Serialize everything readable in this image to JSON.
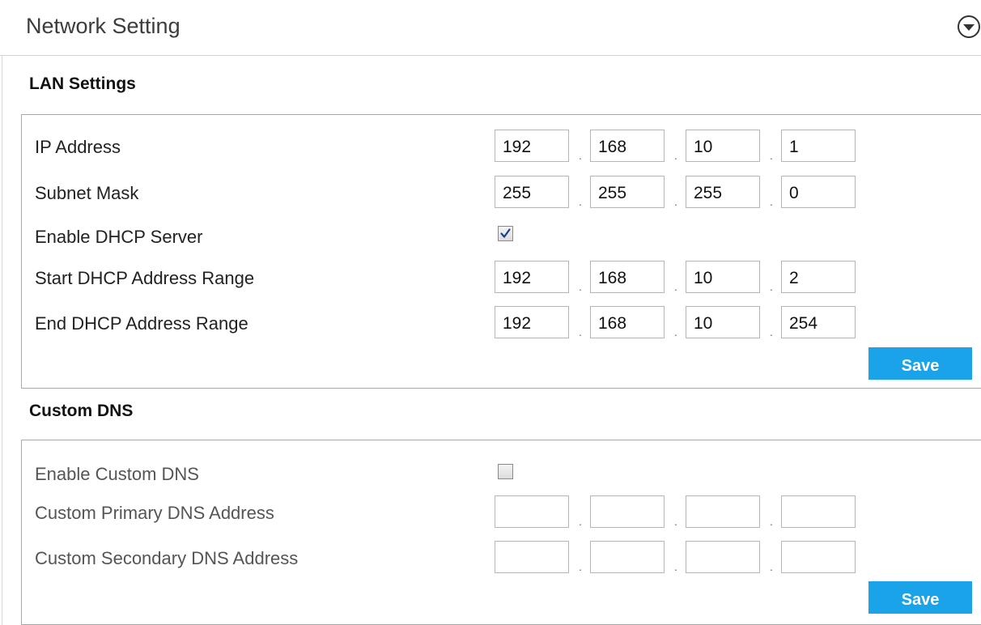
{
  "header": {
    "title": "Network Setting",
    "collapse_icon": "chevron-down-circle-icon"
  },
  "lan": {
    "title": "LAN Settings",
    "ip_address": {
      "label": "IP Address",
      "octets": [
        "192",
        "168",
        "10",
        "1"
      ]
    },
    "subnet_mask": {
      "label": "Subnet Mask",
      "octets": [
        "255",
        "255",
        "255",
        "0"
      ]
    },
    "dhcp": {
      "label": "Enable DHCP Server",
      "checked": true
    },
    "dhcp_start": {
      "label": "Start DHCP Address Range",
      "octets": [
        "192",
        "168",
        "10",
        "2"
      ]
    },
    "dhcp_end": {
      "label": "End DHCP Address Range",
      "octets": [
        "192",
        "168",
        "10",
        "254"
      ]
    },
    "save_label": "Save"
  },
  "dns": {
    "title": "Custom DNS",
    "enable": {
      "label": "Enable Custom DNS",
      "checked": false
    },
    "primary": {
      "label": "Custom Primary DNS Address",
      "octets": [
        "",
        "",
        "",
        ""
      ]
    },
    "secondary": {
      "label": "Custom Secondary DNS Address",
      "octets": [
        "",
        "",
        "",
        ""
      ]
    },
    "save_label": "Save"
  },
  "colors": {
    "accent": "#1aa3e8",
    "panel_border": "#a8a8a8",
    "checkmark": "#1c3d8f"
  }
}
